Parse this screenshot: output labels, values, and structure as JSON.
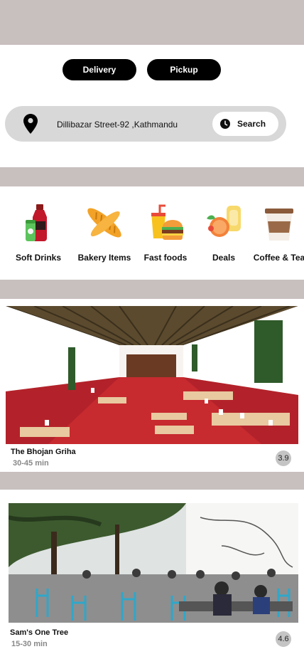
{
  "order_modes": {
    "delivery": "Delivery",
    "pickup": "Pickup"
  },
  "location": {
    "address": "Dillibazar Street-92 ,Kathmandu",
    "search_label": "Search"
  },
  "categories": [
    {
      "label": "Soft Drinks",
      "icon": "soft-drinks-icon"
    },
    {
      "label": "Bakery Items",
      "icon": "bread-icon"
    },
    {
      "label": "Fast foods",
      "icon": "burger-fries-icon"
    },
    {
      "label": "Deals",
      "icon": "deals-icon"
    },
    {
      "label": "Coffee & Tea",
      "icon": "coffee-cup-icon"
    }
  ],
  "restaurants": [
    {
      "name": "The Bhojan Griha",
      "time": "30-45 min",
      "rating": "3.9"
    },
    {
      "name": "Sam's One Tree",
      "time": "15-30 min",
      "rating": "4.6"
    }
  ],
  "colors": {
    "band": "#c8bfbf",
    "button": "#000000",
    "search_bar": "#d8d8d8",
    "rating_badge": "#c4c4c4"
  }
}
